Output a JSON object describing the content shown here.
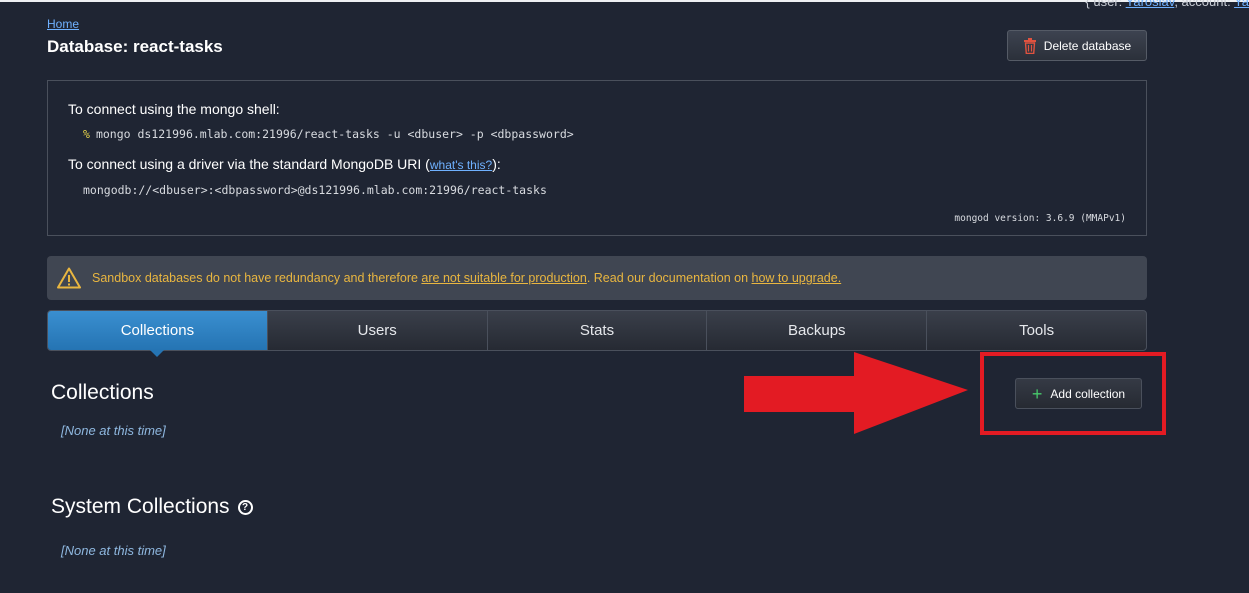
{
  "user_bar": {
    "user_prefix": "{ user: ",
    "user_name": "Yaroslav",
    "account_prefix": ", account: ",
    "account_name": "Ya"
  },
  "breadcrumb": {
    "home": "Home"
  },
  "page_title": "Database: react-tasks",
  "delete_button": {
    "label": "Delete database",
    "icon": "trash-icon"
  },
  "connection": {
    "shell_label": "To connect using the mongo shell:",
    "shell_prompt": "%",
    "shell_command": "mongo ds121996.mlab.com:21996/react-tasks -u <dbuser> -p <dbpassword>",
    "driver_label_prefix": "To connect using a driver via the standard MongoDB URI (",
    "driver_link": "what's this?",
    "driver_label_suffix": "):",
    "uri": "mongodb://<dbuser>:<dbpassword>@ds121996.mlab.com:21996/react-tasks",
    "version": "mongod version: 3.6.9 (MMAPv1)"
  },
  "warning": {
    "icon": "warning-icon",
    "text_1": "Sandbox databases do not have redundancy and therefore ",
    "link_1": "are not suitable for production",
    "text_2": ". Read our documentation on ",
    "link_2": "how to upgrade."
  },
  "tabs": [
    {
      "label": "Collections",
      "active": true
    },
    {
      "label": "Users",
      "active": false
    },
    {
      "label": "Stats",
      "active": false
    },
    {
      "label": "Backups",
      "active": false
    },
    {
      "label": "Tools",
      "active": false
    }
  ],
  "collections": {
    "title": "Collections",
    "empty": "[None at this time]",
    "add_button": "Add collection"
  },
  "system_collections": {
    "title": "System Collections",
    "help_icon": "?",
    "empty": "[None at this time]"
  },
  "colors": {
    "background": "#1f2533",
    "accent": "#2574b3",
    "warning": "#e9b640",
    "annotation_red": "#e31b23"
  }
}
